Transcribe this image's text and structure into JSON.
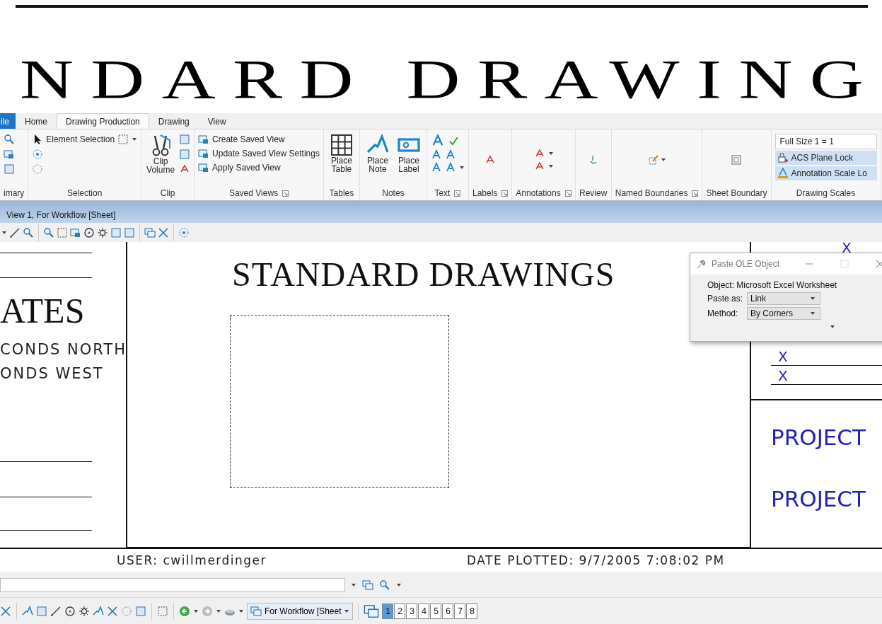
{
  "banner": {
    "text": "NDARD DRAWING"
  },
  "ribbon": {
    "tabs": [
      {
        "label": "ile",
        "kind": "file",
        "selected": false
      },
      {
        "label": "Home",
        "kind": "tab",
        "selected": false
      },
      {
        "label": "Drawing Production",
        "kind": "tab",
        "selected": true
      },
      {
        "label": "Drawing",
        "kind": "tab",
        "selected": false
      },
      {
        "label": "View",
        "kind": "tab",
        "selected": false
      }
    ],
    "groups": [
      {
        "title": "imary",
        "kind": "icons",
        "launcher": false
      },
      {
        "title": "Selection",
        "kind": "selection",
        "launcher": false,
        "items": [
          {
            "label": "Element Selection"
          }
        ]
      },
      {
        "title": "Clip",
        "kind": "clip",
        "launcher": false,
        "items": [
          {
            "label": "Clip Volume"
          }
        ]
      },
      {
        "title": "Saved Views",
        "kind": "list",
        "launcher": true,
        "items": [
          {
            "label": "Create Saved View"
          },
          {
            "label": "Update Saved View Settings"
          },
          {
            "label": "Apply Saved View"
          }
        ]
      },
      {
        "title": "Tables",
        "kind": "big",
        "launcher": false,
        "items": [
          {
            "label": "Place Table"
          }
        ]
      },
      {
        "title": "Notes",
        "kind": "big",
        "launcher": false,
        "items": [
          {
            "label": "Place Note"
          },
          {
            "label": "Place Label"
          }
        ]
      },
      {
        "title": "Text",
        "kind": "text",
        "launcher": true
      },
      {
        "title": "Labels",
        "kind": "single",
        "launcher": true
      },
      {
        "title": "Annotations",
        "kind": "double",
        "launcher": true
      },
      {
        "title": "Review",
        "kind": "single",
        "launcher": false
      },
      {
        "title": "Named Boundaries",
        "kind": "single",
        "launcher": true
      },
      {
        "title": "Sheet Boundary",
        "kind": "single",
        "launcher": false
      },
      {
        "title": "Drawing Scales",
        "kind": "scales",
        "launcher": false,
        "field": "Full Size 1 = 1",
        "items": [
          {
            "label": "ACS Plane Lock",
            "on": true
          },
          {
            "label": "Annotation Scale Lo",
            "on": true
          }
        ]
      }
    ]
  },
  "view": {
    "title": "View 1, For Workflow [Sheet]"
  },
  "sheet": {
    "left_texts": [
      "ATES",
      "CONDS NORTH",
      "ONDS WEST"
    ],
    "title": "STANDARD DRAWINGS",
    "marks": [
      "X",
      "X",
      "X"
    ],
    "projects": [
      "PROJECT",
      "PROJECT"
    ],
    "user": "USER: cwillmerdinger",
    "date": "DATE PLOTTED: 9/7/2005 7:08:02 PM"
  },
  "dialog": {
    "title": "Paste OLE Object",
    "object": "Object: Microsoft Excel Worksheet",
    "fields": [
      {
        "label": "Paste as:",
        "value": "Link"
      },
      {
        "label": "Method:",
        "value": "By Corners"
      }
    ]
  },
  "bottom": {
    "view_select": "For Workflow [Sheet",
    "views": [
      {
        "label": "1",
        "selected": true
      },
      {
        "label": "2",
        "selected": false
      },
      {
        "label": "3",
        "selected": false
      },
      {
        "label": "4",
        "selected": false
      },
      {
        "label": "5",
        "selected": false
      },
      {
        "label": "6",
        "selected": false
      },
      {
        "label": "7",
        "selected": false
      },
      {
        "label": "8",
        "selected": false
      }
    ]
  }
}
